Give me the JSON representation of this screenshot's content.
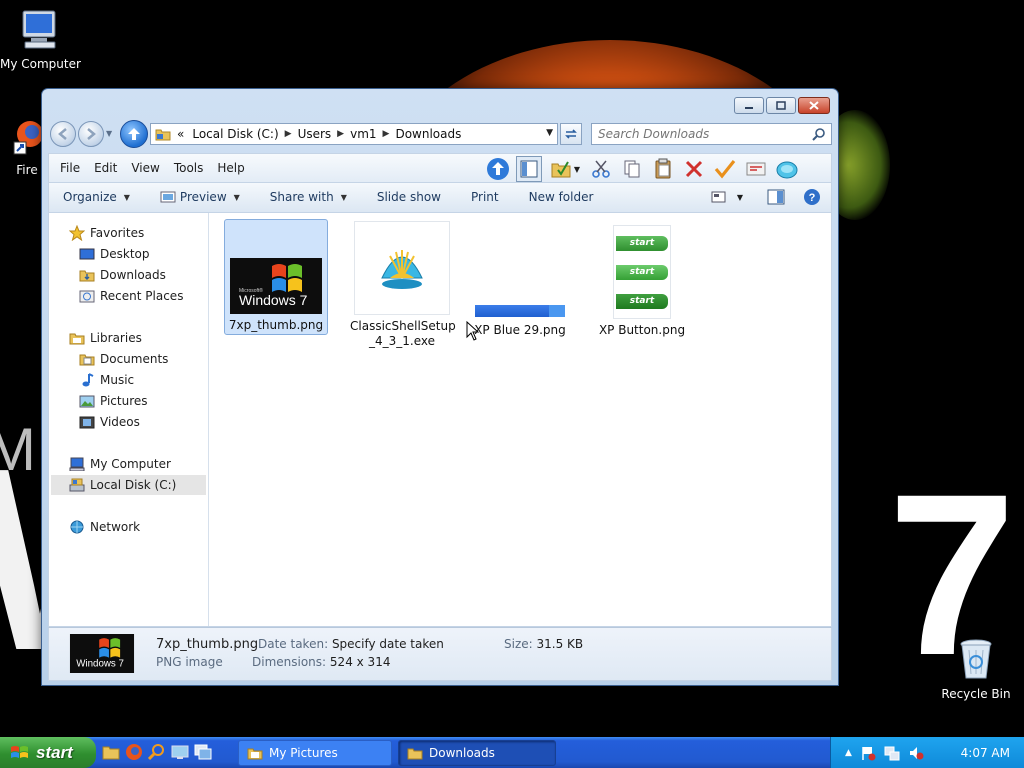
{
  "desktop": {
    "icons": [
      {
        "label": "My Computer"
      },
      {
        "label": "Fire"
      },
      {
        "label": "Recycle Bin"
      }
    ],
    "wallpaper_text": {
      "big_seven": "7",
      "big_w": "W",
      "small_m": "M"
    }
  },
  "window": {
    "address": {
      "prefix": "«",
      "segments": [
        "Local Disk (C:)",
        "Users",
        "vm1",
        "Downloads"
      ]
    },
    "search": {
      "placeholder": "Search Downloads"
    },
    "menu": [
      "File",
      "Edit",
      "View",
      "Tools",
      "Help"
    ],
    "commands": {
      "organize": "Organize",
      "preview": "Preview",
      "share_with": "Share with",
      "slide_show": "Slide show",
      "print": "Print",
      "new_folder": "New folder"
    },
    "nav_pane": {
      "favorites": {
        "label": "Favorites",
        "items": [
          "Desktop",
          "Downloads",
          "Recent Places"
        ]
      },
      "libraries": {
        "label": "Libraries",
        "items": [
          "Documents",
          "Music",
          "Pictures",
          "Videos"
        ]
      },
      "computer": {
        "label": "My Computer",
        "items": [
          "Local Disk (C:)"
        ]
      },
      "network": {
        "label": "Network"
      }
    },
    "files": [
      {
        "name": "7xp_thumb.png",
        "thumb_text": "Windows 7",
        "thumb_small": "Microsoft®"
      },
      {
        "name": "ClassicShellSetup_4_3_1.exe",
        "line1": "ClassicShellSetup",
        "line2": "_4_3_1.exe"
      },
      {
        "name": "XP Blue 29.png"
      },
      {
        "name": "XP Button.png",
        "button_text": "start"
      }
    ],
    "details": {
      "file_name": "7xp_thumb.png",
      "file_type": "PNG image",
      "date_taken_key": "Date taken:",
      "date_taken_val": "Specify date taken",
      "dimensions_key": "Dimensions:",
      "dimensions_val": "524 x 314",
      "size_key": "Size:",
      "size_val": "31.5 KB"
    }
  },
  "taskbar": {
    "start": "start",
    "tasks": [
      "My Pictures",
      "Downloads"
    ],
    "clock": "4:07 AM"
  },
  "colors": {
    "taskbar_blue": "#245edb",
    "start_green": "#2f8f2f",
    "selection": "#cfe3fb",
    "window_frame": "#b9d1ea"
  }
}
